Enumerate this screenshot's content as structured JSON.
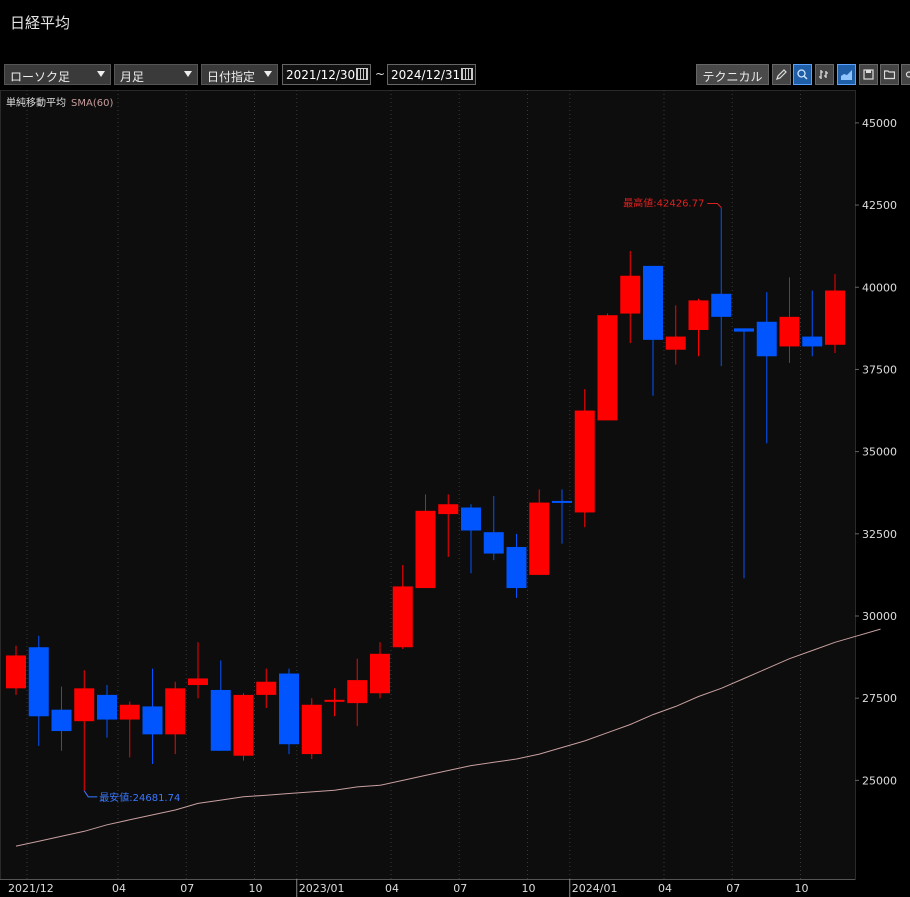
{
  "title": "日経平均",
  "toolbar": {
    "chart_type": "ローソク足",
    "interval": "月足",
    "range_mode": "日付指定",
    "date_from": "2021/12/30",
    "date_to": "2024/12/31",
    "range_separator": "~",
    "technical_label": "テクニカル",
    "icons": [
      "pencil-icon",
      "zoom-icon",
      "bar-chart-icon",
      "area-chart-icon",
      "save-icon",
      "folder-icon",
      "link-icon"
    ]
  },
  "legend": {
    "label": "単純移動平均",
    "series": "SMA(60)"
  },
  "colors": {
    "up": "#ff0000",
    "down": "#0055ff",
    "sma": "#c8a0a0",
    "high_label": "#e02020",
    "low_label": "#3a78ff"
  },
  "chart_data": {
    "type": "candlestick",
    "y_axis": {
      "ticks": [
        25000,
        27500,
        30000,
        32500,
        35000,
        37500,
        40000,
        42500,
        45000
      ],
      "ylim": [
        22000,
        46000
      ]
    },
    "x_tick_labels": [
      "2021/12",
      "04",
      "07",
      "10",
      "2023/01",
      "04",
      "07",
      "10",
      "2024/01",
      "04",
      "07",
      "10"
    ],
    "annotations": {
      "high": "最高値:42426.77",
      "low": "最安値:24681.74"
    },
    "candles": [
      {
        "period": "2021/12",
        "open": 27800,
        "high": 29100,
        "low": 27600,
        "close": 28800
      },
      {
        "period": "2022/01",
        "open": 29050,
        "high": 29400,
        "low": 26050,
        "close": 26950
      },
      {
        "period": "2022/02",
        "open": 27150,
        "high": 27850,
        "low": 25900,
        "close": 26500
      },
      {
        "period": "2022/03",
        "open": 26800,
        "high": 28350,
        "low": 24681.74,
        "close": 27800
      },
      {
        "period": "2022/04",
        "open": 27600,
        "high": 27900,
        "low": 26300,
        "close": 26850
      },
      {
        "period": "2022/05",
        "open": 26850,
        "high": 27400,
        "low": 25700,
        "close": 27300
      },
      {
        "period": "2022/06",
        "open": 27250,
        "high": 28400,
        "low": 25500,
        "close": 26400
      },
      {
        "period": "2022/07",
        "open": 26400,
        "high": 28000,
        "low": 25800,
        "close": 27800
      },
      {
        "period": "2022/08",
        "open": 27900,
        "high": 29200,
        "low": 27500,
        "close": 28100
      },
      {
        "period": "2022/09",
        "open": 27750,
        "high": 28650,
        "low": 25950,
        "close": 25900
      },
      {
        "period": "2022/10",
        "open": 25750,
        "high": 27650,
        "low": 25600,
        "close": 27600
      },
      {
        "period": "2022/11",
        "open": 27600,
        "high": 28400,
        "low": 27200,
        "close": 28000
      },
      {
        "period": "2022/12",
        "open": 28250,
        "high": 28400,
        "low": 25800,
        "close": 26100
      },
      {
        "period": "2023/01",
        "open": 25800,
        "high": 27500,
        "low": 25650,
        "close": 27300
      },
      {
        "period": "2023/02",
        "open": 27450,
        "high": 27800,
        "low": 26950,
        "close": 27450
      },
      {
        "period": "2023/03",
        "open": 27350,
        "high": 28700,
        "low": 26650,
        "close": 28050
      },
      {
        "period": "2023/04",
        "open": 27650,
        "high": 29200,
        "low": 27500,
        "close": 28850
      },
      {
        "period": "2023/05",
        "open": 29050,
        "high": 31550,
        "low": 29000,
        "close": 30900
      },
      {
        "period": "2023/06",
        "open": 30850,
        "high": 33700,
        "low": 30850,
        "close": 33200
      },
      {
        "period": "2023/07",
        "open": 33100,
        "high": 33700,
        "low": 31800,
        "close": 33400
      },
      {
        "period": "2023/08",
        "open": 33300,
        "high": 33400,
        "low": 31300,
        "close": 32600
      },
      {
        "period": "2023/09",
        "open": 32550,
        "high": 33650,
        "low": 31700,
        "close": 31900
      },
      {
        "period": "2023/10",
        "open": 32100,
        "high": 32500,
        "low": 30550,
        "close": 30850
      },
      {
        "period": "2023/11",
        "open": 31250,
        "high": 33850,
        "low": 31250,
        "close": 33450
      },
      {
        "period": "2023/12",
        "open": 33500,
        "high": 33850,
        "low": 32200,
        "close": 33450
      },
      {
        "period": "2024/01",
        "open": 33150,
        "high": 36900,
        "low": 32700,
        "close": 36250
      },
      {
        "period": "2024/02",
        "open": 35950,
        "high": 39200,
        "low": 35950,
        "close": 39150
      },
      {
        "period": "2024/03",
        "open": 39200,
        "high": 41100,
        "low": 38300,
        "close": 40350
      },
      {
        "period": "2024/04",
        "open": 40650,
        "high": 40650,
        "low": 36700,
        "close": 38400
      },
      {
        "period": "2024/05",
        "open": 38100,
        "high": 39450,
        "low": 37650,
        "close": 38500
      },
      {
        "period": "2024/06",
        "open": 38700,
        "high": 39650,
        "low": 37900,
        "close": 39600
      },
      {
        "period": "2024/07",
        "open": 39800,
        "high": 42426.77,
        "low": 37600,
        "close": 39100
      },
      {
        "period": "2024/08",
        "open": 38750,
        "high": 38750,
        "low": 31150,
        "close": 38650
      },
      {
        "period": "2024/09",
        "open": 38950,
        "high": 39850,
        "low": 35250,
        "close": 37900
      },
      {
        "period": "2024/10",
        "open": 38200,
        "high": 40300,
        "low": 37700,
        "close": 39100
      },
      {
        "period": "2024/11",
        "open": 38500,
        "high": 39900,
        "low": 37900,
        "close": 38200
      },
      {
        "period": "2024/12",
        "open": 38250,
        "high": 40400,
        "low": 38000,
        "close": 39900
      }
    ],
    "sma": [
      23000,
      23150,
      23300,
      23450,
      23650,
      23800,
      23950,
      24100,
      24300,
      24400,
      24500,
      24550,
      24600,
      24650,
      24700,
      24800,
      24850,
      25000,
      25150,
      25300,
      25450,
      25550,
      25650,
      25800,
      26000,
      26200,
      26450,
      26700,
      27000,
      27250,
      27550,
      27800,
      28100,
      28400,
      28700,
      28950,
      29200,
      29400,
      29600
    ]
  }
}
